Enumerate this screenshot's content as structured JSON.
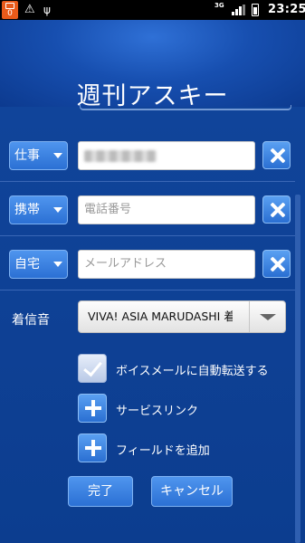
{
  "status_bar": {
    "notification_badge": "0",
    "network": "3G",
    "time": "23:25",
    "icons": [
      "notification-icon",
      "warning-icon",
      "usb-icon",
      "signal-icon",
      "battery-icon"
    ]
  },
  "header": {
    "title": "週刊アスキー"
  },
  "phone_rows": [
    {
      "type": "仕事",
      "value": "",
      "placeholder": ""
    },
    {
      "type": "携帯",
      "value": "",
      "placeholder": "電話番号"
    },
    {
      "type": "自宅",
      "value": "",
      "placeholder": "メールアドレス"
    }
  ],
  "ringtone": {
    "label": "着信音",
    "selected": "VIVA! ASIA MARUDASHI 着"
  },
  "options": {
    "voicemail_label": "ボイスメールに自動転送する",
    "voicemail_checked": true,
    "service_link_label": "サービスリンク",
    "add_field_label": "フィールドを追加"
  },
  "actions": {
    "done_label": "完了",
    "cancel_label": "キャンセル"
  },
  "colors": {
    "background": "#0c3d8f",
    "accent": "#2b70d4",
    "notification": "#e85a1a"
  }
}
